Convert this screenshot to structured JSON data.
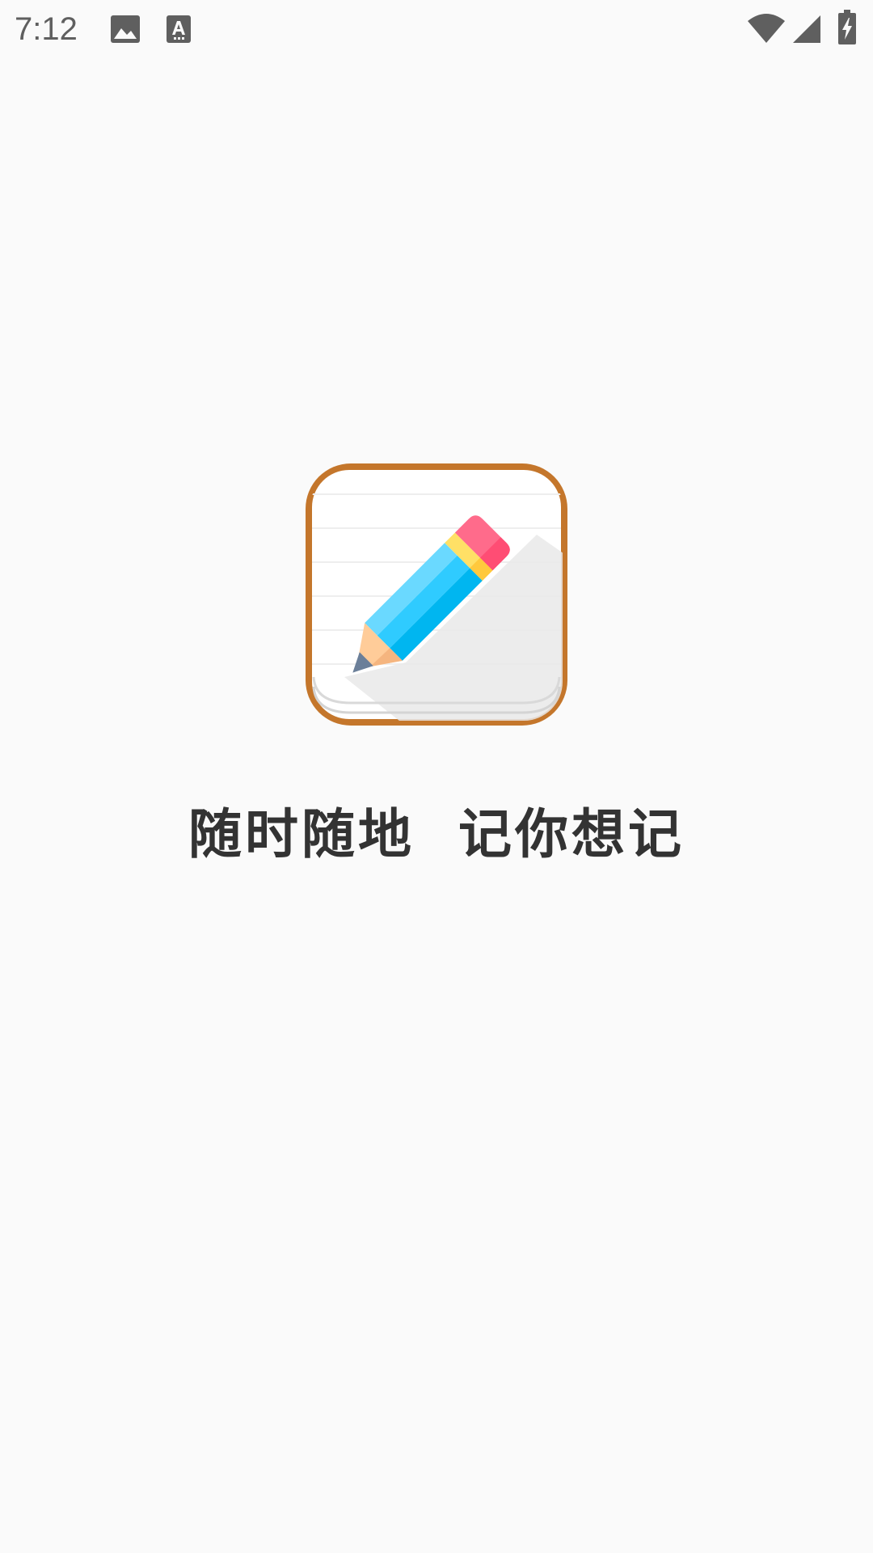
{
  "status_bar": {
    "time": "7:12",
    "icons": [
      "image-icon",
      "font-a-icon",
      "wifi-icon",
      "cell-signal-icon",
      "battery-charging-icon"
    ],
    "icon_color": "#5f5f5f"
  },
  "splash": {
    "logo": "notebook-pencil-logo",
    "tagline": "随时随地  记你想记",
    "colors": {
      "background": "#fafafa",
      "logo_border": "#c4762b",
      "pencil_blue": "#00c3ff",
      "eraser_pink": "#ff6b8b",
      "band_yellow": "#ffe066",
      "tagline_text": "#333333"
    }
  }
}
